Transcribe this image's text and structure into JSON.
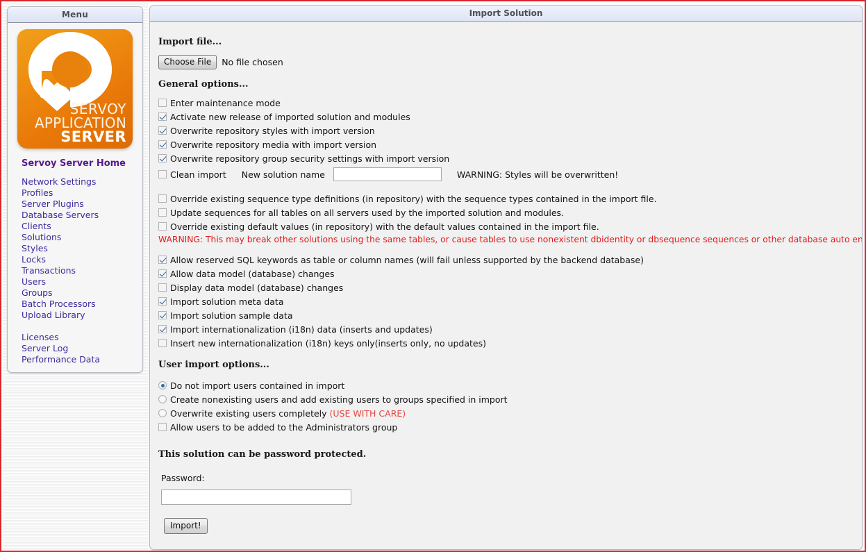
{
  "sidebar": {
    "header": "Menu",
    "logo": {
      "line1": "SERVOY",
      "line2": "APPLICATION",
      "line3": "SERVER",
      "bg_color": "#e8820c"
    },
    "home_title": "Servoy Server Home",
    "link_color": "#3f2a9e",
    "items": [
      {
        "label": "Network Settings"
      },
      {
        "label": "Profiles"
      },
      {
        "label": "Server Plugins"
      },
      {
        "label": "Database Servers"
      },
      {
        "label": "Clients"
      },
      {
        "label": "Solutions"
      },
      {
        "label": "Styles"
      },
      {
        "label": "Locks"
      },
      {
        "label": "Transactions"
      },
      {
        "label": "Users"
      },
      {
        "label": "Groups"
      },
      {
        "label": "Batch Processors"
      },
      {
        "label": "Upload Library"
      }
    ],
    "items2": [
      {
        "label": "Licenses"
      },
      {
        "label": "Server Log"
      },
      {
        "label": "Performance Data"
      }
    ]
  },
  "main": {
    "header": "Import Solution",
    "import_file": {
      "heading": "Import file...",
      "choose_button": "Choose File",
      "file_status": "No file chosen"
    },
    "general_options": {
      "heading": "General options...",
      "group1": [
        {
          "label": "Enter maintenance mode",
          "checked": false
        },
        {
          "label": "Activate new release of imported solution and modules",
          "checked": true
        },
        {
          "label": "Overwrite repository styles with import version",
          "checked": true
        },
        {
          "label": "Overwrite repository media with import version",
          "checked": true
        },
        {
          "label": "Overwrite repository group security settings with import version",
          "checked": true
        }
      ],
      "clean_import": {
        "label": "Clean import",
        "checked": false,
        "new_solution_label": "New solution name",
        "new_solution_value": "",
        "new_solution_placeholder": "",
        "warning": "WARNING: Styles will be overwritten!"
      },
      "group2": [
        {
          "label": "Override existing sequence type definitions (in repository) with the sequence types contained in the import file.",
          "checked": false
        },
        {
          "label": "Update sequences for all tables on all servers used by the imported solution and modules.",
          "checked": false
        },
        {
          "label": "Override existing default values (in repository) with the default values contained in the import file.",
          "checked": false
        }
      ],
      "red_warning": "WARNING: This may break other solutions using the same tables, or cause tables to use nonexistent dbidentity or dbsequence sequences or other database auto enter types!",
      "red_warning_color": "#e01b1b",
      "group3": [
        {
          "label": "Allow reserved SQL keywords as table or column names (will fail unless supported by the backend database)",
          "checked": true
        },
        {
          "label": "Allow data model (database) changes",
          "checked": true
        },
        {
          "label": "Display data model (database) changes",
          "checked": false
        },
        {
          "label": "Import solution meta data",
          "checked": true
        },
        {
          "label": "Import solution sample data",
          "checked": true
        },
        {
          "label": "Import internationalization (i18n) data (inserts and updates)",
          "checked": true
        },
        {
          "label": "Insert new internationalization (i18n) keys only(inserts only, no updates)",
          "checked": false
        }
      ]
    },
    "user_import_options": {
      "heading": "User import options...",
      "radios": [
        {
          "label": "Do not import users contained in import",
          "selected": true,
          "suffix": ""
        },
        {
          "label": "Create nonexisting users and add existing users to groups specified in import",
          "selected": false,
          "suffix": ""
        },
        {
          "label": "Overwrite existing users completely",
          "selected": false,
          "suffix": "(USE WITH CARE)"
        }
      ],
      "admin_checkbox": {
        "label": "Allow users to be added to the Administrators group",
        "checked": false
      }
    },
    "password_section": {
      "heading": "This solution can be password protected.",
      "label": "Password:",
      "value": "",
      "placeholder": ""
    },
    "import_button": "Import!"
  }
}
